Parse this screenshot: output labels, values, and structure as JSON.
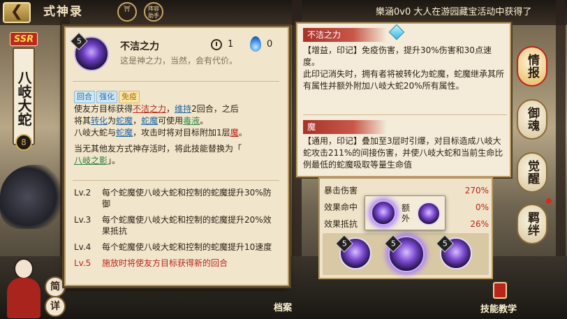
{
  "header": {
    "title": "式神录",
    "icon1_label": "",
    "icon2_label": "阵容\n助手",
    "ticker": "樂涵0v0 大人在游园藏宝活动中获得了"
  },
  "shikigami": {
    "rarity": "SSR",
    "name": "八岐大蛇",
    "rank_glyph": "8"
  },
  "left_buttons": {
    "brief": "简",
    "detail": "详"
  },
  "skill": {
    "level": "5",
    "name": "不洁之力",
    "quote": "这是神之力，当然，会有代价。",
    "cooldown": "1",
    "orb_cost": "0",
    "tags": [
      "回合",
      "强化",
      "免疫"
    ],
    "desc": {
      "l1a": "使友方目标获得",
      "l1kw": "不洁之力",
      "l1b": "，",
      "l1kw2": "维持",
      "l1c": "2回合，之后",
      "l2a": "将其",
      "l2kw": "转化",
      "l2b": "为",
      "l2kw2": "蛇魔",
      "l2c": "，",
      "l2kw3": "蛇魔",
      "l2d": "可使用",
      "l2kw4": "毒液",
      "l2e": "。",
      "l3a": "八岐大蛇与",
      "l3kw": "蛇魔",
      "l3b": "，攻击时将对目标附加1层",
      "l3kw2": "魔",
      "l3c": "。",
      "l4": "当无其他友方式神存活时，将此技能替换为「",
      "l5kw": "八岐之影",
      "l5b": "」。"
    },
    "levels": [
      {
        "lv": "Lv.2",
        "text": "每个蛇魔使八岐大蛇和控制的蛇魔提升30%防御"
      },
      {
        "lv": "Lv.3",
        "text": "每个蛇魔使八岐大蛇和控制的蛇魔提升20%效果抵抗"
      },
      {
        "lv": "Lv.4",
        "text": "每个蛇魔使八岐大蛇和控制的蛇魔提升10速度"
      },
      {
        "lv": "Lv.5",
        "text": "施放时将使友方目标获得新的回合"
      }
    ]
  },
  "tooltip": {
    "head1": "不洁之力",
    "text1a": "【增益，印记】免疫伤害，提升30%伤害和30点速度。",
    "text1b": "此印记消失时，拥有者将被转化为蛇魔，蛇魔继承其所有属性并额外附加八岐大蛇20%所有属性。",
    "head2": "魔",
    "text2": "【通用，印记】叠加至3层时引爆，对目标造成八岐大蛇攻击211%的间接伤害，并使八岐大蛇和当前生命比例最低的蛇魔吸取等量生命值"
  },
  "stats": [
    {
      "label": "暴击伤害",
      "value": "270%"
    },
    {
      "label": "效果命中",
      "value": "0%"
    },
    {
      "label": "效果抵抗",
      "value": "26%"
    }
  ],
  "popup": {
    "text": "额外"
  },
  "skill_slots": [
    "5",
    "5",
    "5"
  ],
  "side_tabs": [
    "情报",
    "御魂",
    "觉醒",
    "羁绊"
  ],
  "bottom": {
    "teach": "技能教学",
    "archive": "档案"
  },
  "colors": {
    "accent_red": "#b8251a",
    "card_bg": "#f1e6cc",
    "purple_orb": "#7a48d0"
  }
}
